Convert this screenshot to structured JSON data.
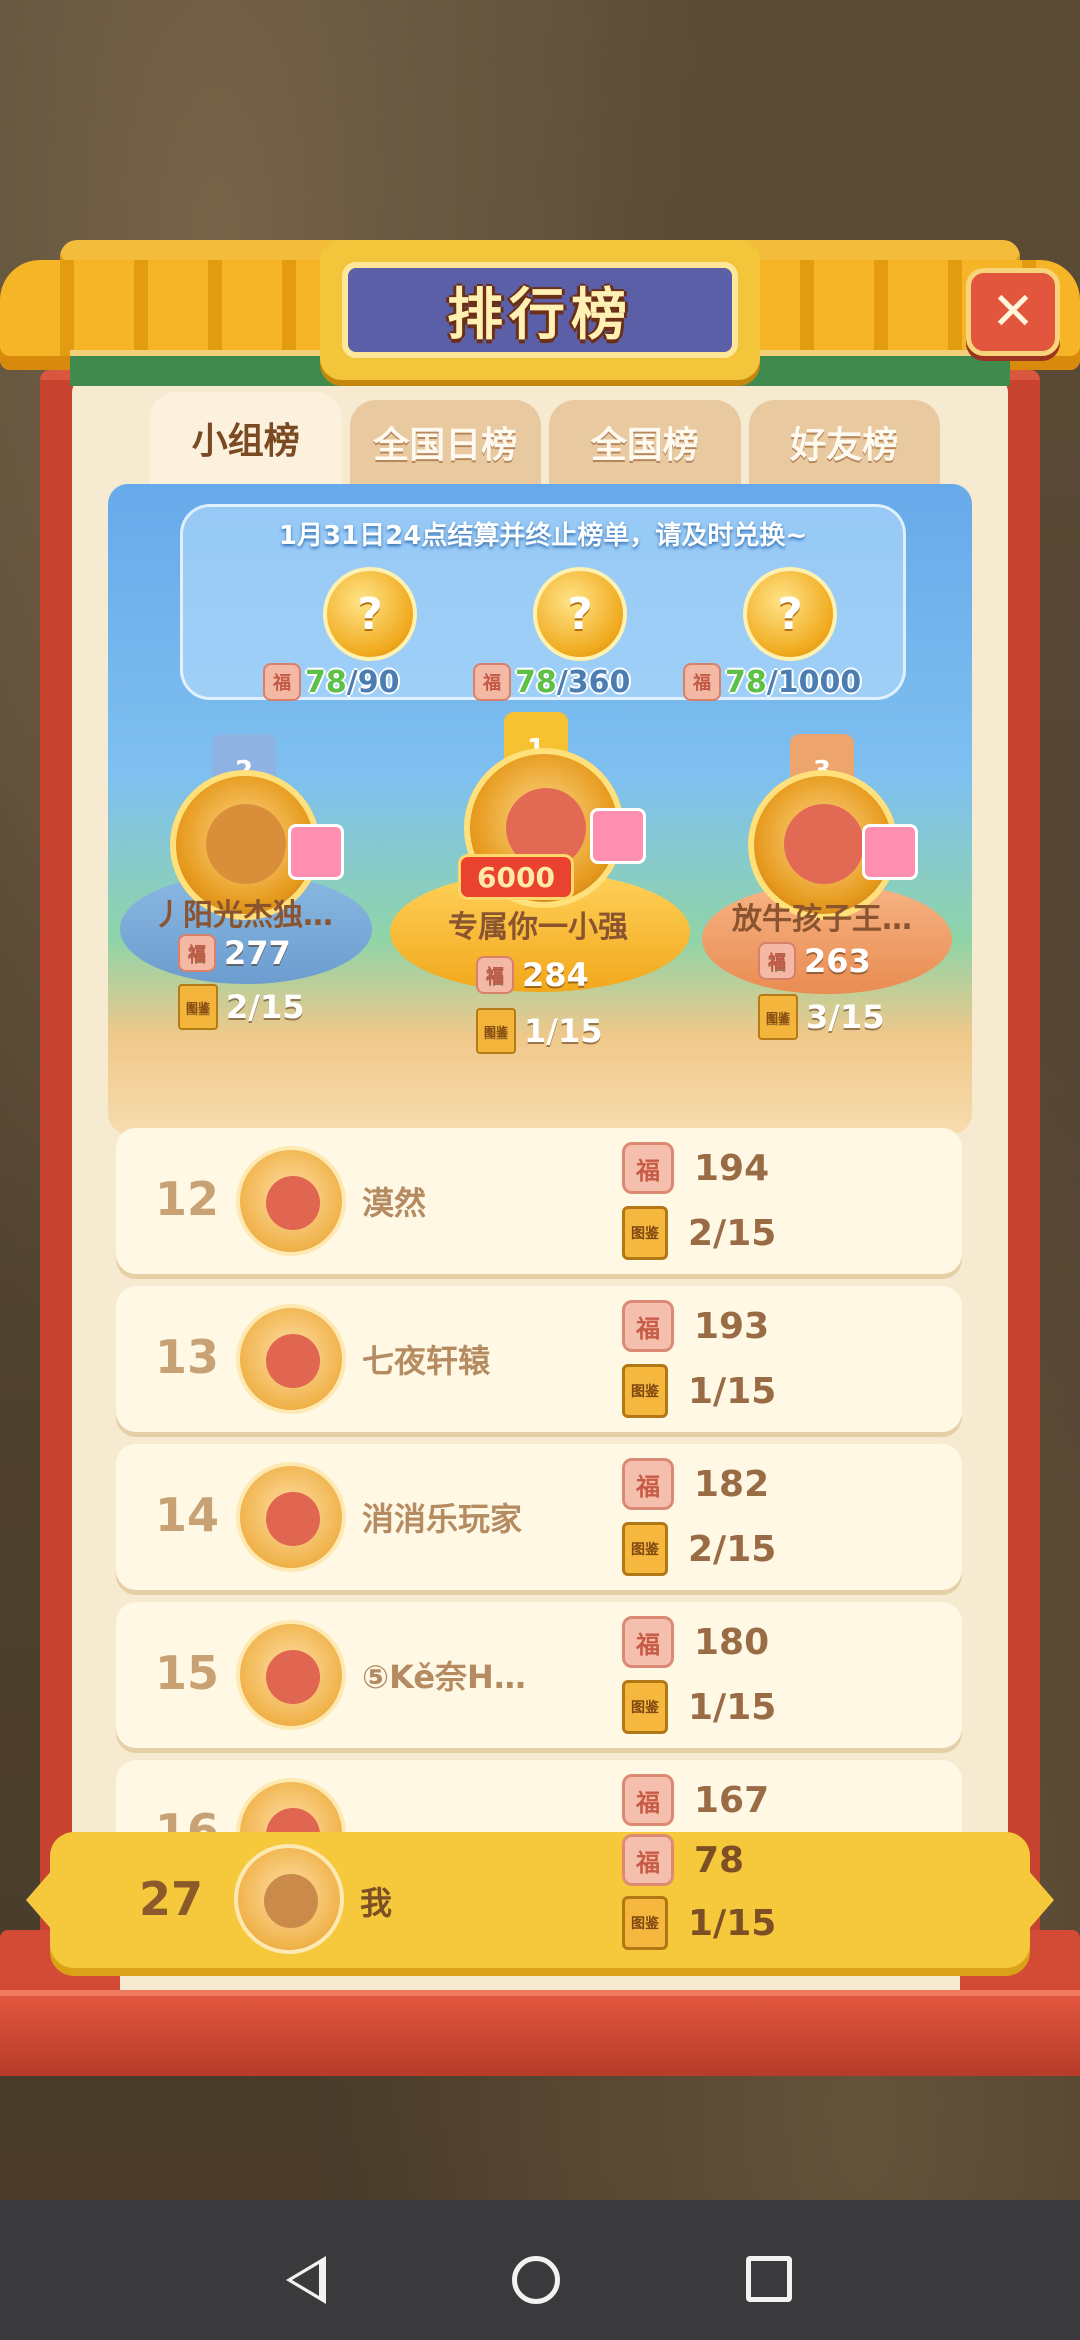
{
  "title": "排行榜",
  "tabs": [
    "小组榜",
    "全国日榜",
    "全国榜",
    "好友榜"
  ],
  "notice": "1月31日24点结算并终止榜单，请及时兑换~",
  "rewards": [
    {
      "current": "78",
      "sep": "/",
      "total": "90"
    },
    {
      "current": "78",
      "sep": "/",
      "total": "360"
    },
    {
      "current": "78",
      "sep": "/",
      "total": "1000"
    }
  ],
  "podium": {
    "first": {
      "crown": "1",
      "name": "专属你一小强",
      "score": "284",
      "progress": "1/15",
      "badge": "6000"
    },
    "second": {
      "crown": "2",
      "name": "丿阳光杰独…",
      "score": "277",
      "progress": "2/15"
    },
    "third": {
      "crown": "3",
      "name": "放牛孩子王…",
      "score": "263",
      "progress": "3/15"
    }
  },
  "icons": {
    "coin": "福",
    "book": "图鉴",
    "question": "?"
  },
  "rows": [
    {
      "rank": "12",
      "name": "漠然",
      "score": "194",
      "progress": "2/15"
    },
    {
      "rank": "13",
      "name": "七夜轩辕",
      "score": "193",
      "progress": "1/15"
    },
    {
      "rank": "14",
      "name": "消消乐玩家",
      "score": "182",
      "progress": "2/15"
    },
    {
      "rank": "15",
      "name": "⑤Kě奈H…",
      "score": "180",
      "progress": "1/15"
    },
    {
      "rank": "16",
      "name": "",
      "score": "167",
      "progress": ""
    }
  ],
  "me": {
    "rank": "27",
    "name": "我",
    "score": "78",
    "progress": "1/15"
  },
  "colors": {
    "frame": "#d9563f",
    "roof": "#f6b526",
    "panel_blue": "#67a9ea",
    "my_row": "#f6c93d",
    "title_plate": "#5b5fa8"
  }
}
